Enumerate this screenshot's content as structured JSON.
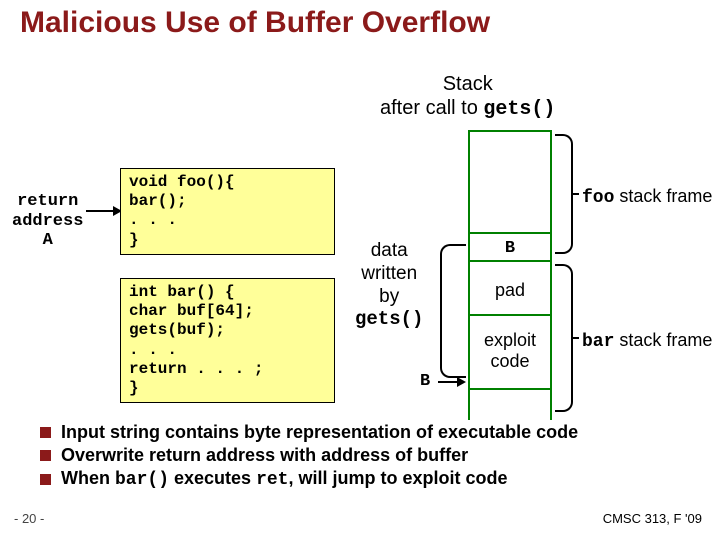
{
  "title": "Malicious Use of Buffer Overflow",
  "stack_caption_line1": "Stack",
  "stack_caption_line2_pre": "after call to ",
  "stack_caption_line2_code": "gets()",
  "return_label_l1": "return",
  "return_label_l2": "address",
  "return_label_l3": "A",
  "code_foo_l1": "void foo(){",
  "code_foo_l2": "  bar();",
  "code_foo_l3": "  . . .",
  "code_foo_l4": "}",
  "code_bar_l1": "int bar() {",
  "code_bar_l2": "  char buf[64];",
  "code_bar_l3": "  gets(buf);",
  "code_bar_l4": "  . . .",
  "code_bar_l5": "  return . . . ;",
  "code_bar_l6": "}",
  "data_written_l1": "data",
  "data_written_l2": "written",
  "data_written_l3": "by",
  "data_written_code": "gets()",
  "b_source_label": "B",
  "cell_b": "B",
  "cell_pad": "pad",
  "cell_exploit_l1": "exploit",
  "cell_exploit_l2": "code",
  "foo_frame_code": "foo",
  "foo_frame_tail": " stack frame",
  "bar_frame_code": "bar",
  "bar_frame_tail": " stack frame",
  "bullet1": "Input string contains byte representation of executable code",
  "bullet2": "Overwrite return address with address of buffer",
  "bullet3_pre": "When ",
  "bullet3_code1": "bar()",
  "bullet3_mid": " executes ",
  "bullet3_code2": "ret",
  "bullet3_tail": ", will jump to exploit code",
  "page_num": "- 20 -",
  "course": "CMSC 313, F '09"
}
